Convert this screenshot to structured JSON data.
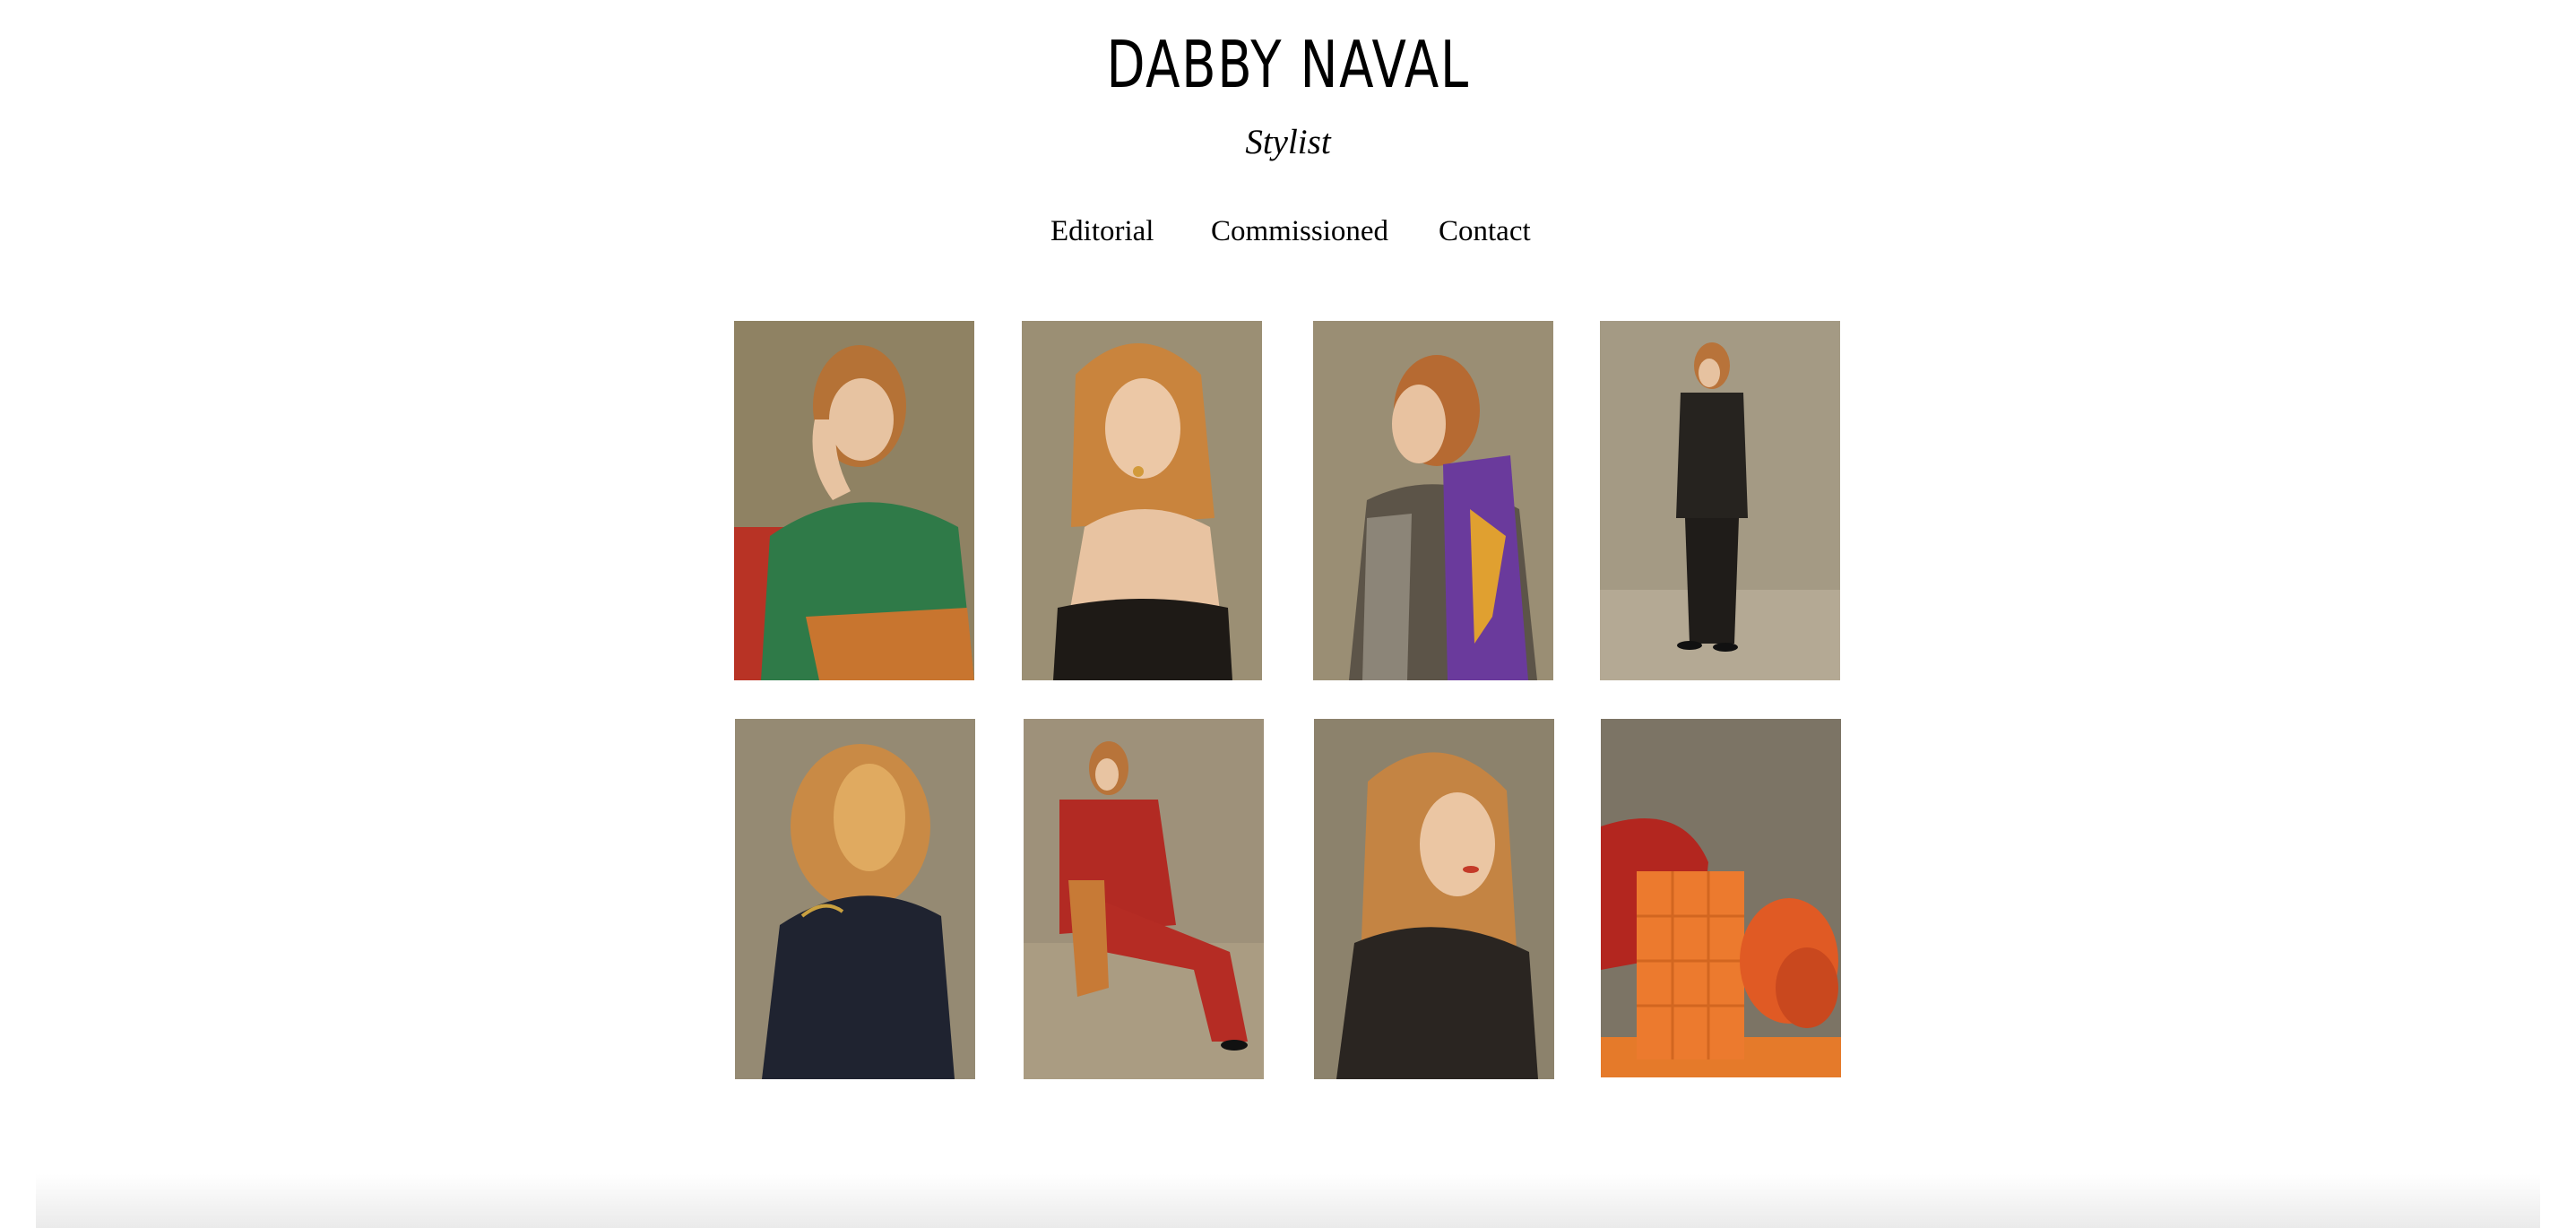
{
  "header": {
    "title": "DABBY NAVAL",
    "subtitle": "Stylist"
  },
  "nav": {
    "items": [
      {
        "label": "Editorial"
      },
      {
        "label": "Commissioned"
      },
      {
        "label": "Contact"
      }
    ]
  },
  "gallery": {
    "photos": [
      {
        "subject": "woman-green-satin-blouse"
      },
      {
        "subject": "woman-black-strapless-dress"
      },
      {
        "subject": "woman-houndstooth-jacket-scarf"
      },
      {
        "subject": "woman-black-suit-standing"
      },
      {
        "subject": "woman-back-dark-jacket"
      },
      {
        "subject": "woman-red-suit-seated"
      },
      {
        "subject": "woman-black-leather-jacket"
      },
      {
        "subject": "orange-handbag-still-life"
      }
    ]
  }
}
